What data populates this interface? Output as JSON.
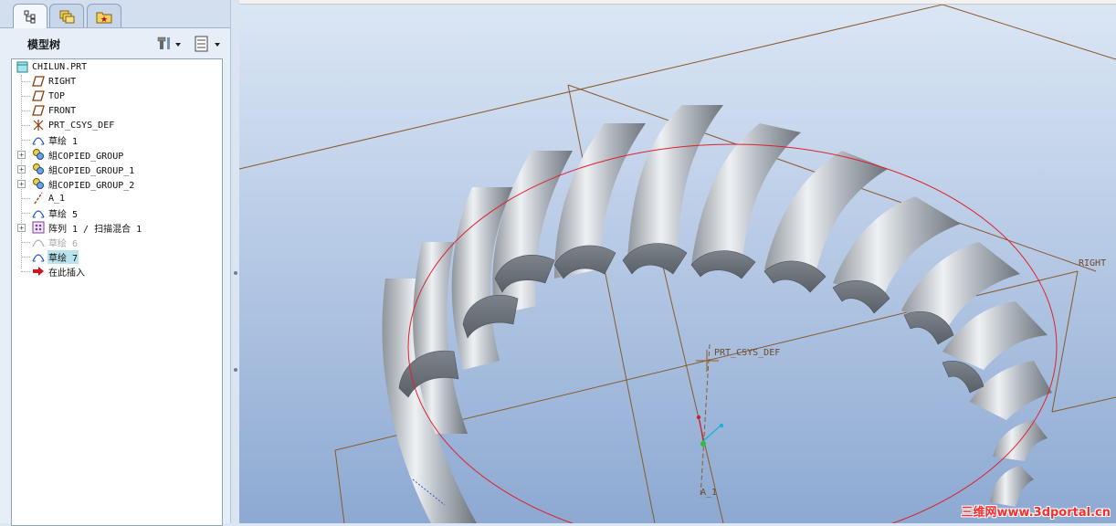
{
  "panel": {
    "title": "模型树",
    "tabs": [
      "model-tree-tab",
      "layers-tab",
      "favorites-tab"
    ]
  },
  "tree": {
    "root": "CHILUN.PRT",
    "items": [
      {
        "label": "RIGHT",
        "icon": "datum-plane-icon"
      },
      {
        "label": "TOP",
        "icon": "datum-plane-icon"
      },
      {
        "label": "FRONT",
        "icon": "datum-plane-icon"
      },
      {
        "label": "PRT_CSYS_DEF",
        "icon": "csys-icon"
      },
      {
        "label": "草绘 1",
        "icon": "sketch-icon"
      },
      {
        "label": "組COPIED_GROUP",
        "icon": "group-icon",
        "expandable": true
      },
      {
        "label": "組COPIED_GROUP_1",
        "icon": "group-icon",
        "expandable": true
      },
      {
        "label": "組COPIED_GROUP_2",
        "icon": "group-icon",
        "expandable": true
      },
      {
        "label": "A_1",
        "icon": "datum-axis-icon"
      },
      {
        "label": "草绘 5",
        "icon": "sketch-icon"
      },
      {
        "label": "阵列 1 / 扫描混合 1",
        "icon": "pattern-icon",
        "expandable": true
      },
      {
        "label": "草绘 6",
        "icon": "sketch-icon",
        "state": "suppressed"
      },
      {
        "label": "草绘 7",
        "icon": "sketch-icon",
        "state": "selected"
      },
      {
        "label": "在此插入",
        "icon": "insert-here-arrow-icon"
      }
    ]
  },
  "viewport": {
    "labels": {
      "right": "RIGHT",
      "csys": "PRT_CSYS_DEF",
      "axis": "A_1"
    },
    "watermark": "三维网www.3dportal.cn",
    "colors": {
      "background_top": "#dbe6f5",
      "background_bottom": "#8da9d2",
      "datum": "#8a5a2b",
      "sketch": "#e0202a"
    }
  }
}
